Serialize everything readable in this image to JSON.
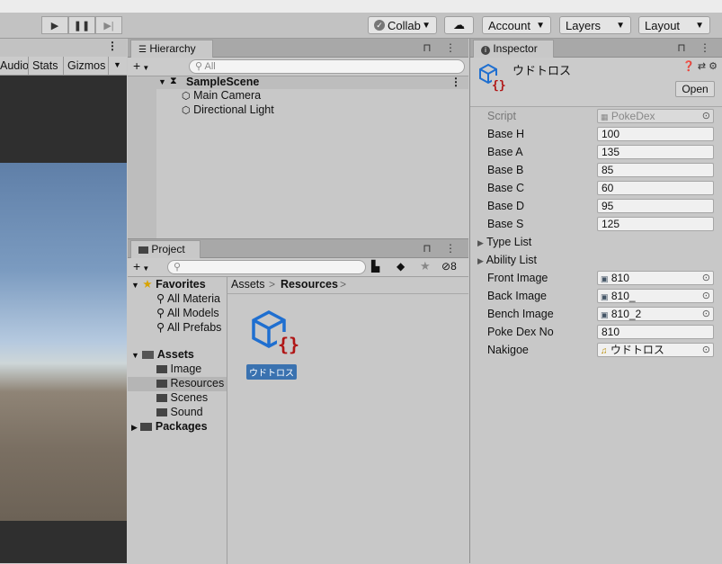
{
  "toolbar": {
    "collab_label": "Collab",
    "account_label": "Account",
    "layers_label": "Layers",
    "layout_label": "Layout"
  },
  "game_view": {
    "audio_label": "Audio",
    "stats_label": "Stats",
    "gizmos_label": "Gizmos"
  },
  "hierarchy": {
    "tab_label": "Hierarchy",
    "search_placeholder": "All",
    "scene_name": "SampleScene",
    "objects": [
      "Main Camera",
      "Directional Light"
    ]
  },
  "project": {
    "tab_label": "Project",
    "hidden_count": "8",
    "favorites_label": "Favorites",
    "favorites": [
      "All Materia",
      "All Models",
      "All Prefabs"
    ],
    "assets_label": "Assets",
    "asset_folders": [
      "Image",
      "Resources",
      "Scenes",
      "Sound"
    ],
    "packages_label": "Packages",
    "breadcrumb_root": "Assets",
    "breadcrumb_current": "Resources",
    "asset_item_name": "ウドトロス"
  },
  "inspector": {
    "tab_label": "Inspector",
    "object_name": "ウドトロス",
    "open_label": "Open",
    "script_label": "Script",
    "script_value": "PokeDex",
    "base_fields": [
      {
        "label": "Base H",
        "value": "100"
      },
      {
        "label": "Base A",
        "value": "135"
      },
      {
        "label": "Base B",
        "value": "85"
      },
      {
        "label": "Base C",
        "value": "60"
      },
      {
        "label": "Base D",
        "value": "95"
      },
      {
        "label": "Base S",
        "value": "125"
      }
    ],
    "type_list_label": "Type List",
    "ability_list_label": "Ability List",
    "front_image_label": "Front Image",
    "front_image_value": "810",
    "back_image_label": "Back Image",
    "back_image_value": "810_",
    "bench_image_label": "Bench Image",
    "bench_image_value": "810_2",
    "poke_dex_no_label": "Poke Dex No",
    "poke_dex_no_value": "810",
    "nakigoe_label": "Nakigoe",
    "nakigoe_value": "ウドトロス"
  },
  "colors": {
    "selection_blue": "#3a72b0",
    "script_icon_blue": "#1f6fd0",
    "script_icon_red": "#b01515"
  }
}
